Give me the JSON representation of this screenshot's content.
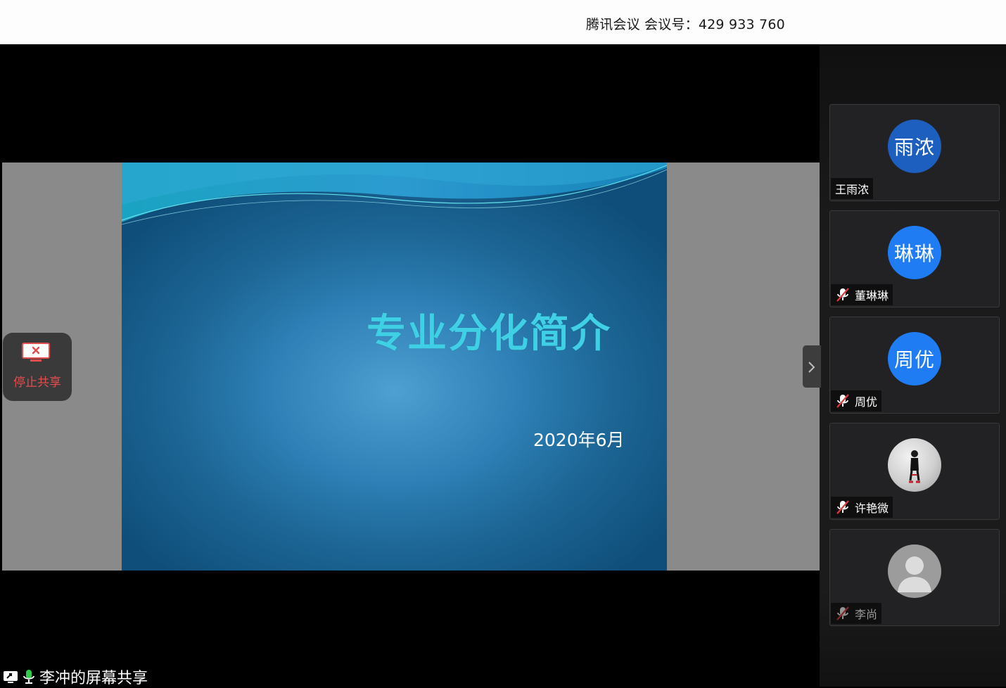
{
  "meeting": {
    "title": "腾讯会议 会议号：429 933 760"
  },
  "slide": {
    "title": "专业分化简介",
    "date": "2020年6月"
  },
  "stop_share": {
    "label": "停止共享"
  },
  "share_status": {
    "label": "李冲的屏幕共享"
  },
  "participants": [
    {
      "avatar_text": "雨浓",
      "name": "王雨浓",
      "muted": false,
      "avatar_color": "#1d5fbf"
    },
    {
      "avatar_text": "琳琳",
      "name": "董琳琳",
      "muted": true,
      "avatar_color": "#1f7cf2"
    },
    {
      "avatar_text": "周优",
      "name": "周优",
      "muted": true,
      "avatar_color": "#1f7cf2"
    },
    {
      "avatar_text": "",
      "name": "许艳微",
      "muted": true,
      "avatar_icon": "photo-avatar"
    },
    {
      "avatar_text": "",
      "name": "李尚",
      "muted": true,
      "avatar_icon": "default-person-avatar"
    }
  ],
  "colors": {
    "stop_share_red": "#e44d4d",
    "slide_title_cyan": "#3fd0e6",
    "mute_red": "#e03a3a"
  }
}
